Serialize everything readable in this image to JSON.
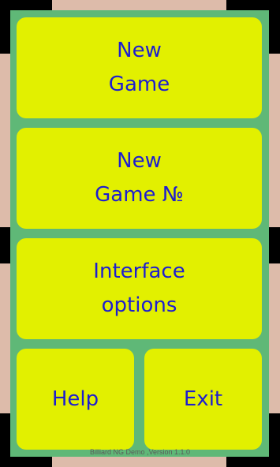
{
  "menu": {
    "new_game": {
      "line1": "New",
      "line2": "Game"
    },
    "new_game_number": {
      "line1": "New",
      "line2": "Game №"
    },
    "interface_options": {
      "line1": "Interface",
      "line2": "options"
    },
    "help": "Help",
    "exit": "Exit"
  },
  "footer": {
    "version_text": "Billiard NG Demo ,Version 1.1.0"
  },
  "colors": {
    "background": "#000000",
    "panel": "#5fb877",
    "button": "#e2f000",
    "button_text": "#1d1dd0",
    "decor": "#ddbbaa"
  }
}
